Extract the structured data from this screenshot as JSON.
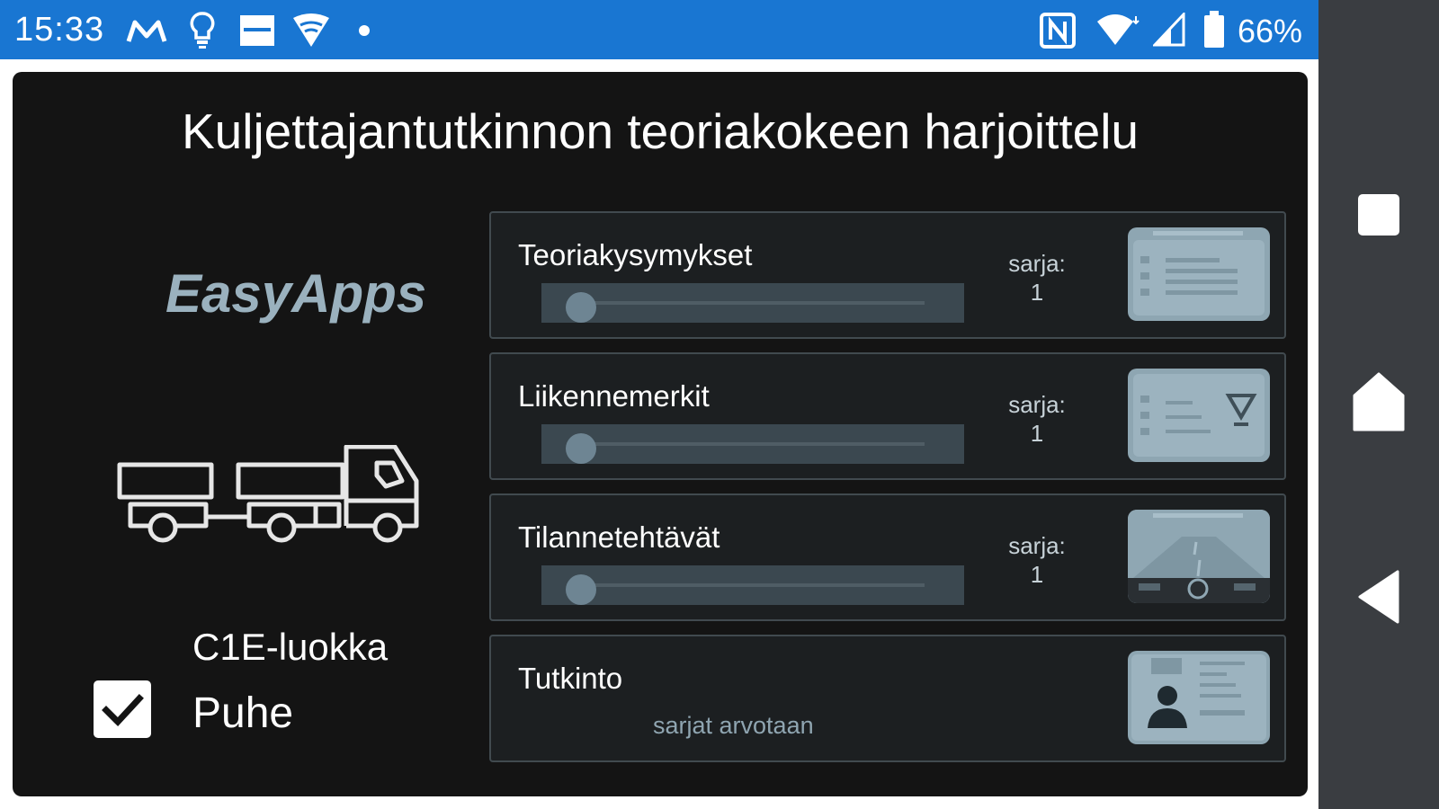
{
  "status_bar": {
    "time": "15:33",
    "left_icons": [
      "gmail-m-icon",
      "bulb-icon",
      "news-icon",
      "wifi-shield-icon",
      "dot-icon"
    ],
    "right_icons": [
      "nfc-icon",
      "wifi-icon",
      "cell-signal-icon",
      "battery-icon"
    ],
    "battery": "66%",
    "color": "#1976d2"
  },
  "nav_bar": {
    "buttons": [
      "recents-square-icon",
      "home-icon",
      "back-triangle-icon"
    ]
  },
  "app": {
    "title": "Kuljettajantutkinnon teoriakokeen harjoittelu",
    "brand": "EasyApps",
    "vehicle_icon": "truck-with-trailer-icon",
    "class_label": "C1E-luokka",
    "voice": {
      "label": "Puhe",
      "checked": true
    },
    "cards": [
      {
        "title": "Teoriakysymykset",
        "series_label": "sarja:",
        "series_value": "1",
        "slider_value": 0,
        "icon": "question-card-icon"
      },
      {
        "title": "Liikennemerkit",
        "series_label": "sarja:",
        "series_value": "1",
        "slider_value": 0,
        "icon": "traffic-sign-card-icon"
      },
      {
        "title": "Tilannetehtävät",
        "series_label": "sarja:",
        "series_value": "1",
        "slider_value": 0,
        "icon": "road-situation-card-icon"
      },
      {
        "title": "Tutkinto",
        "note": "sarjat arvotaan",
        "icon": "license-card-icon"
      }
    ]
  }
}
